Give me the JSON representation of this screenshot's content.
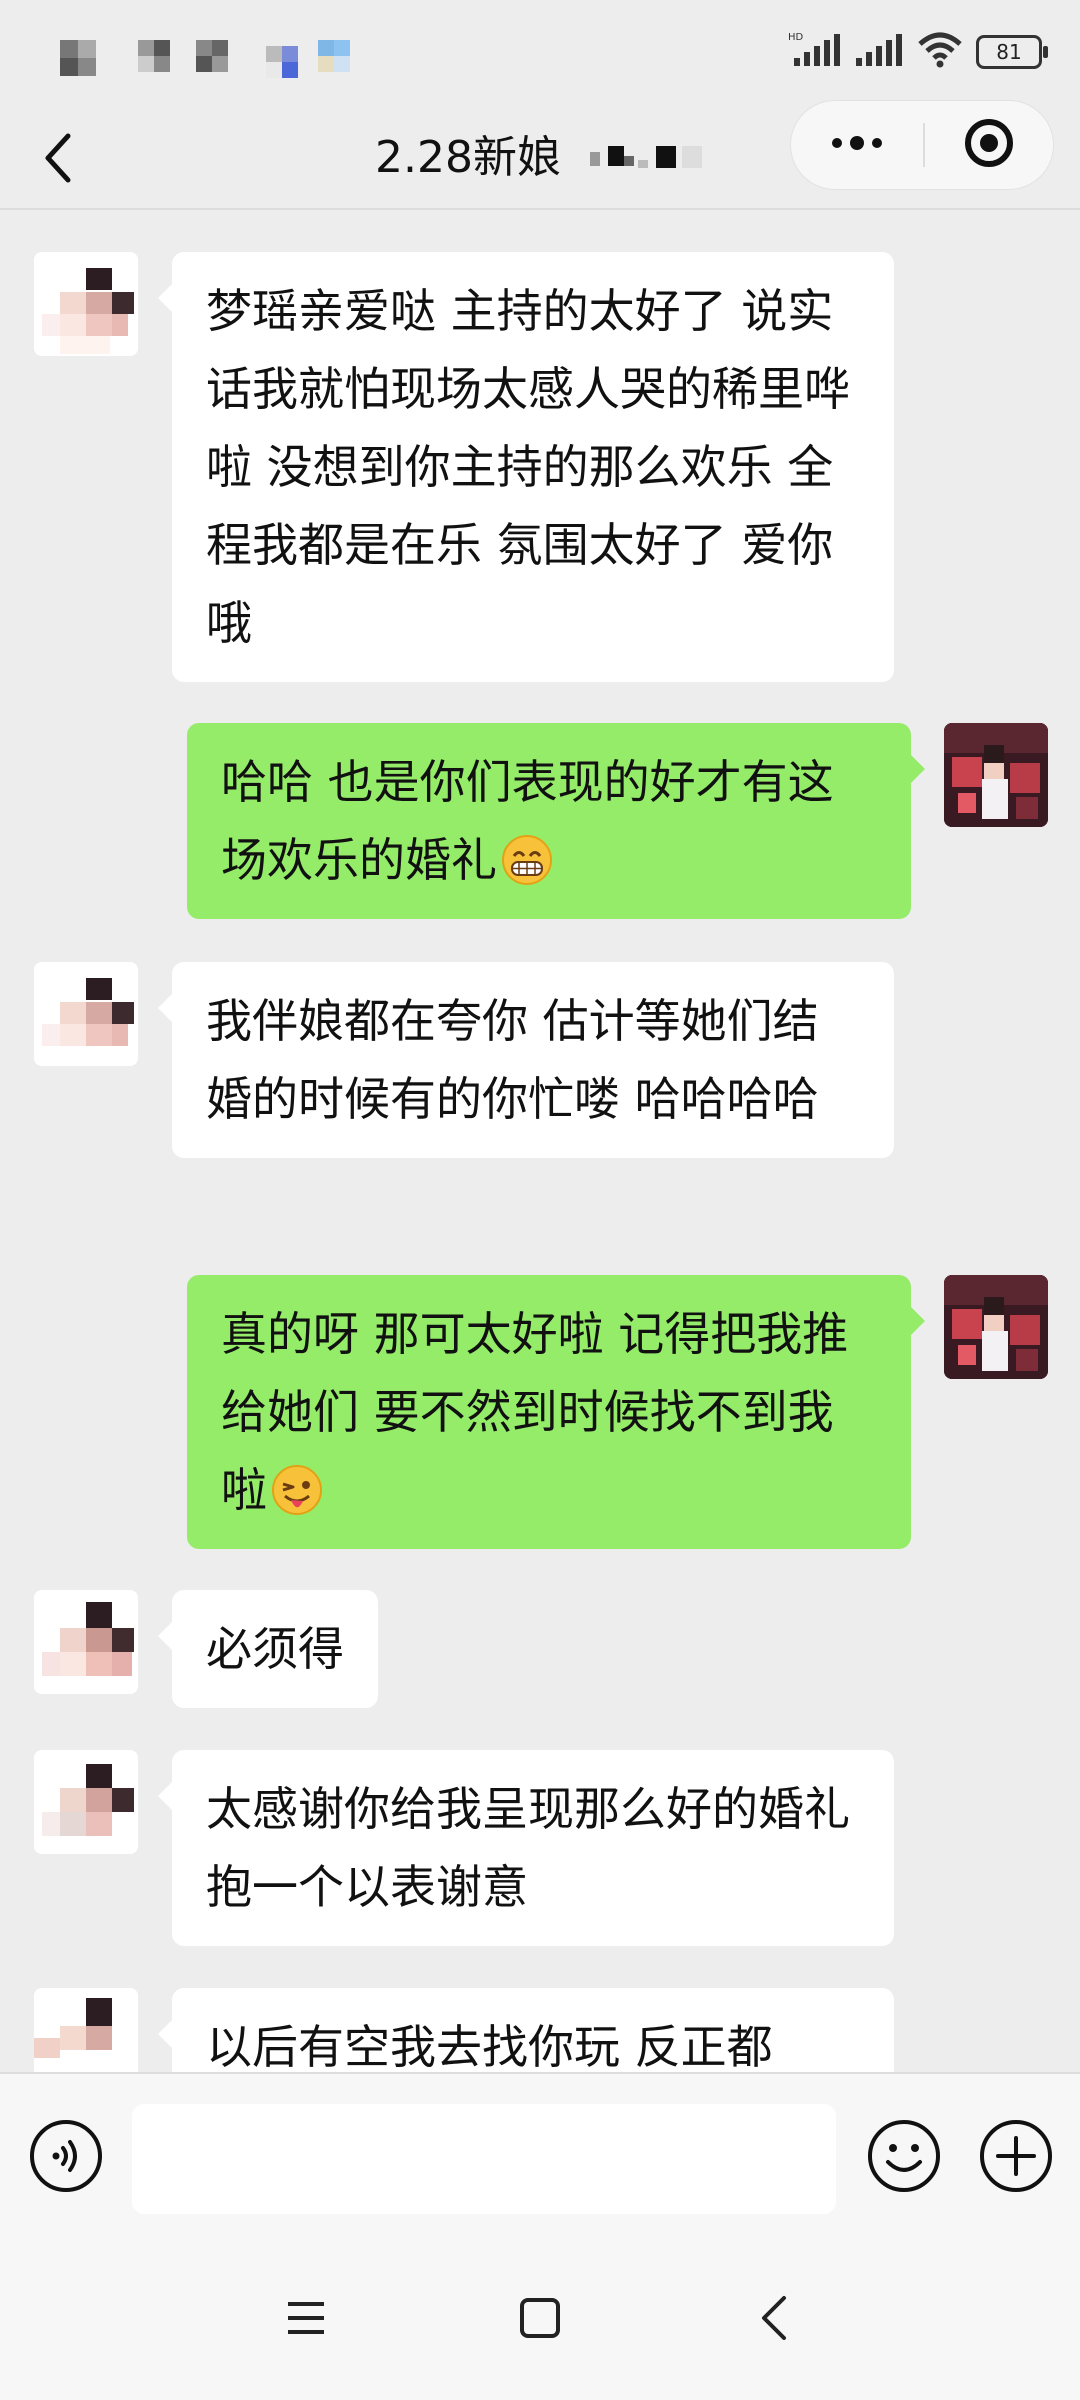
{
  "status_bar": {
    "battery_level": "81",
    "icons": [
      "hd-signal-icon",
      "signal-icon",
      "wifi-icon",
      "battery-icon"
    ]
  },
  "header": {
    "title": "2.28新娘",
    "back_icon": "chevron-left-icon",
    "more_icon": "more-dots-icon",
    "close_icon": "target-circle-icon"
  },
  "messages": [
    {
      "side": "in",
      "text": "梦瑶亲爱哒 主持的太好了 说实话我就怕现场太感人哭的稀里哗啦 没想到你主持的那么欢乐 全程我都是在乐 氛围太好了 爱你哦"
    },
    {
      "side": "out",
      "text": "哈哈 也是你们表现的好才有这场欢乐的婚礼",
      "emoji": "grin-emoji"
    },
    {
      "side": "in",
      "text": "我伴娘都在夸你 估计等她们结婚的时候有的你忙喽 哈哈哈哈"
    },
    {
      "side": "out",
      "text": "真的呀  那可太好啦 记得把我推给她们 要不然到时候找不到我啦",
      "emoji": "tongue-wink-emoji"
    },
    {
      "side": "in",
      "text": "必须得"
    },
    {
      "side": "in",
      "text": "太感谢你给我呈现那么好的婚礼 抱一个以表谢意"
    },
    {
      "side": "in",
      "text": "以后有空我去找你玩 反正都"
    }
  ],
  "input_bar": {
    "voice_icon": "voice-icon",
    "input_value": "",
    "emoji_icon": "smiley-icon",
    "plus_icon": "plus-icon"
  },
  "nav_bar": {
    "icons": [
      "menu-icon",
      "home-square-icon",
      "back-triangle-icon"
    ]
  },
  "colors": {
    "background": "#ededed",
    "incoming_bubble": "#ffffff",
    "outgoing_bubble": "#95ec69"
  }
}
